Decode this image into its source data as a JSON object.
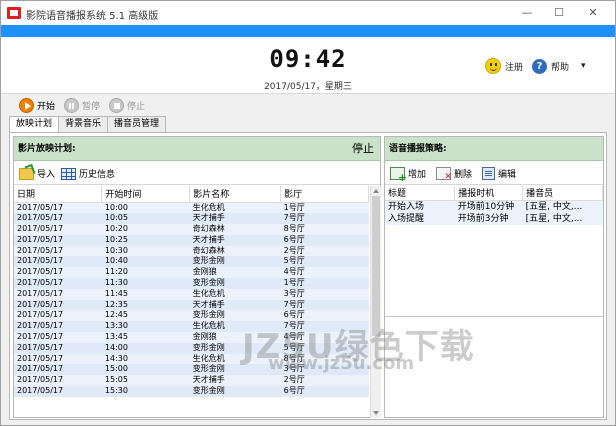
{
  "window": {
    "title": "影院语音播报系统 5.1 高级版",
    "minimize": "—",
    "maximize": "☐",
    "close": "✕"
  },
  "colors": {
    "accent": "#1e90ff",
    "panel_header": "#c9e2c9",
    "row_highlight": "#ebf2fc"
  },
  "clock": {
    "time": "09:42",
    "date": "2017/05/17，星期三"
  },
  "header_buttons": {
    "register": "注册",
    "help": "帮助",
    "help_arrow": "▾"
  },
  "controls": {
    "start": "开始",
    "pause": "暂停",
    "stop": "停止"
  },
  "tabs": [
    {
      "label": "放映计划"
    },
    {
      "label": "背景音乐"
    },
    {
      "label": "播音员管理"
    }
  ],
  "schedule_panel": {
    "title": "影片放映计划:",
    "status": "停止",
    "import_label": "导入",
    "history_label": "历史信息",
    "columns": [
      "日期",
      "开始时间",
      "影片名称",
      "影厅"
    ],
    "rows": [
      [
        "2017/05/17",
        "10:00",
        "生化危机",
        "1号厅"
      ],
      [
        "2017/05/17",
        "10:05",
        "天才捕手",
        "7号厅"
      ],
      [
        "2017/05/17",
        "10:20",
        "奇幻森林",
        "8号厅"
      ],
      [
        "2017/05/17",
        "10:25",
        "天才捕手",
        "6号厅"
      ],
      [
        "2017/05/17",
        "10:30",
        "奇幻森林",
        "2号厅"
      ],
      [
        "2017/05/17",
        "10:40",
        "变形金刚",
        "5号厅"
      ],
      [
        "2017/05/17",
        "11:20",
        "金刚狼",
        "4号厅"
      ],
      [
        "2017/05/17",
        "11:30",
        "变形金刚",
        "1号厅"
      ],
      [
        "2017/05/17",
        "11:45",
        "生化危机",
        "3号厅"
      ],
      [
        "2017/05/17",
        "12:35",
        "天才捕手",
        "7号厅"
      ],
      [
        "2017/05/17",
        "12:45",
        "变形金刚",
        "6号厅"
      ],
      [
        "2017/05/17",
        "13:30",
        "生化危机",
        "7号厅"
      ],
      [
        "2017/05/17",
        "13:45",
        "金刚狼",
        "4号厅"
      ],
      [
        "2017/05/17",
        "14:00",
        "变形金刚",
        "5号厅"
      ],
      [
        "2017/05/17",
        "14:30",
        "生化危机",
        "8号厅"
      ],
      [
        "2017/05/17",
        "15:00",
        "变形金刚",
        "3号厅"
      ],
      [
        "2017/05/17",
        "15:05",
        "天才捕手",
        "2号厅"
      ],
      [
        "2017/05/17",
        "15:30",
        "变形金刚",
        "6号厅"
      ]
    ]
  },
  "strategy_panel": {
    "title": "语音播报策略:",
    "add_label": "增加",
    "delete_label": "删除",
    "edit_label": "编辑",
    "columns": [
      "标题",
      "播报时机",
      "播音员"
    ],
    "rows": [
      [
        "开始入场",
        "开场前10分钟",
        "[五星, 中文,..."
      ],
      [
        "入场提醒",
        "开场前3分钟",
        "[五星, 中文,..."
      ]
    ]
  },
  "watermark": {
    "line1": "JZ5U绿色下载",
    "line2": "www.jz5u.com"
  }
}
